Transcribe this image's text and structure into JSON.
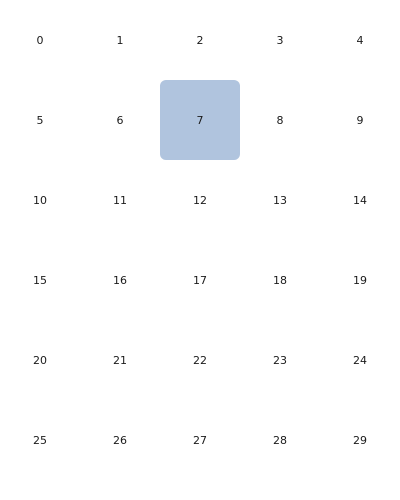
{
  "grid": {
    "columns": 5,
    "selected_index": 7,
    "selected_color": "#b0c4de",
    "cells": [
      "0",
      "1",
      "2",
      "3",
      "4",
      "5",
      "6",
      "7",
      "8",
      "9",
      "10",
      "11",
      "12",
      "13",
      "14",
      "15",
      "16",
      "17",
      "18",
      "19",
      "20",
      "21",
      "22",
      "23",
      "24",
      "25",
      "26",
      "27",
      "28",
      "29"
    ]
  }
}
